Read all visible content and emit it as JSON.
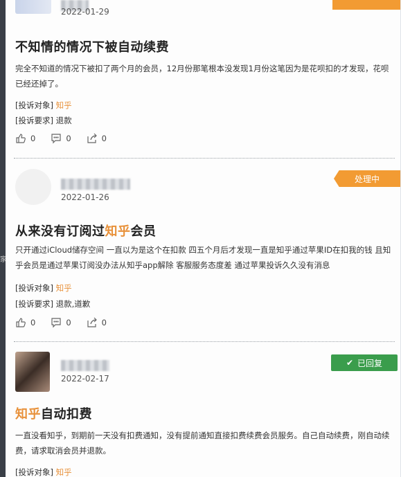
{
  "posts": [
    {
      "date": "2022-01-29",
      "title": "不知情的情况下被自动续费",
      "body": "完全不知道的情况下被扣了两个月的会员，12月份那笔根本没发现1月份这笔因为是花呗扣的才发现，花呗已经还掉了。",
      "object_label": "[投诉对象]",
      "object_value": "知乎",
      "request_label": "[投诉要求]",
      "request_value": "退款",
      "likes": "0",
      "comments": "0",
      "shares": "0"
    },
    {
      "date": "2022-01-26",
      "status": "处理中",
      "title_pre": "从来没有订阅过",
      "title_hl": "知乎",
      "title_post": "会员",
      "body": "只开通过iCloud储存空间 一直以为是这个在扣款 四五个月后才发现一直是知乎通过苹果ID在扣我的钱 且知乎会员是通过苹果订阅没办法从知乎app解除 客服服务态度差 通过苹果投诉久久没有消息",
      "object_label": "[投诉对象]",
      "object_value": "知乎",
      "request_label": "[投诉要求]",
      "request_value": "退款,道歉",
      "likes": "0",
      "comments": "0",
      "shares": "0"
    },
    {
      "date": "2022-02-17",
      "status": "已回复",
      "title_hl": "知乎",
      "title_post": "自动扣费",
      "body": "一直没看知乎，到期前一天没有扣费通知，没有提前通知直接扣费续费会员服务。自己自动续费，刚自动续费，请求取消会员并退款。",
      "object_label": "[投诉对象]",
      "object_value": "知乎"
    }
  ],
  "side_mark": "家",
  "colors": {
    "accent": "#e8913a",
    "processing": "#f29b33",
    "replied": "#3a9d4c"
  }
}
